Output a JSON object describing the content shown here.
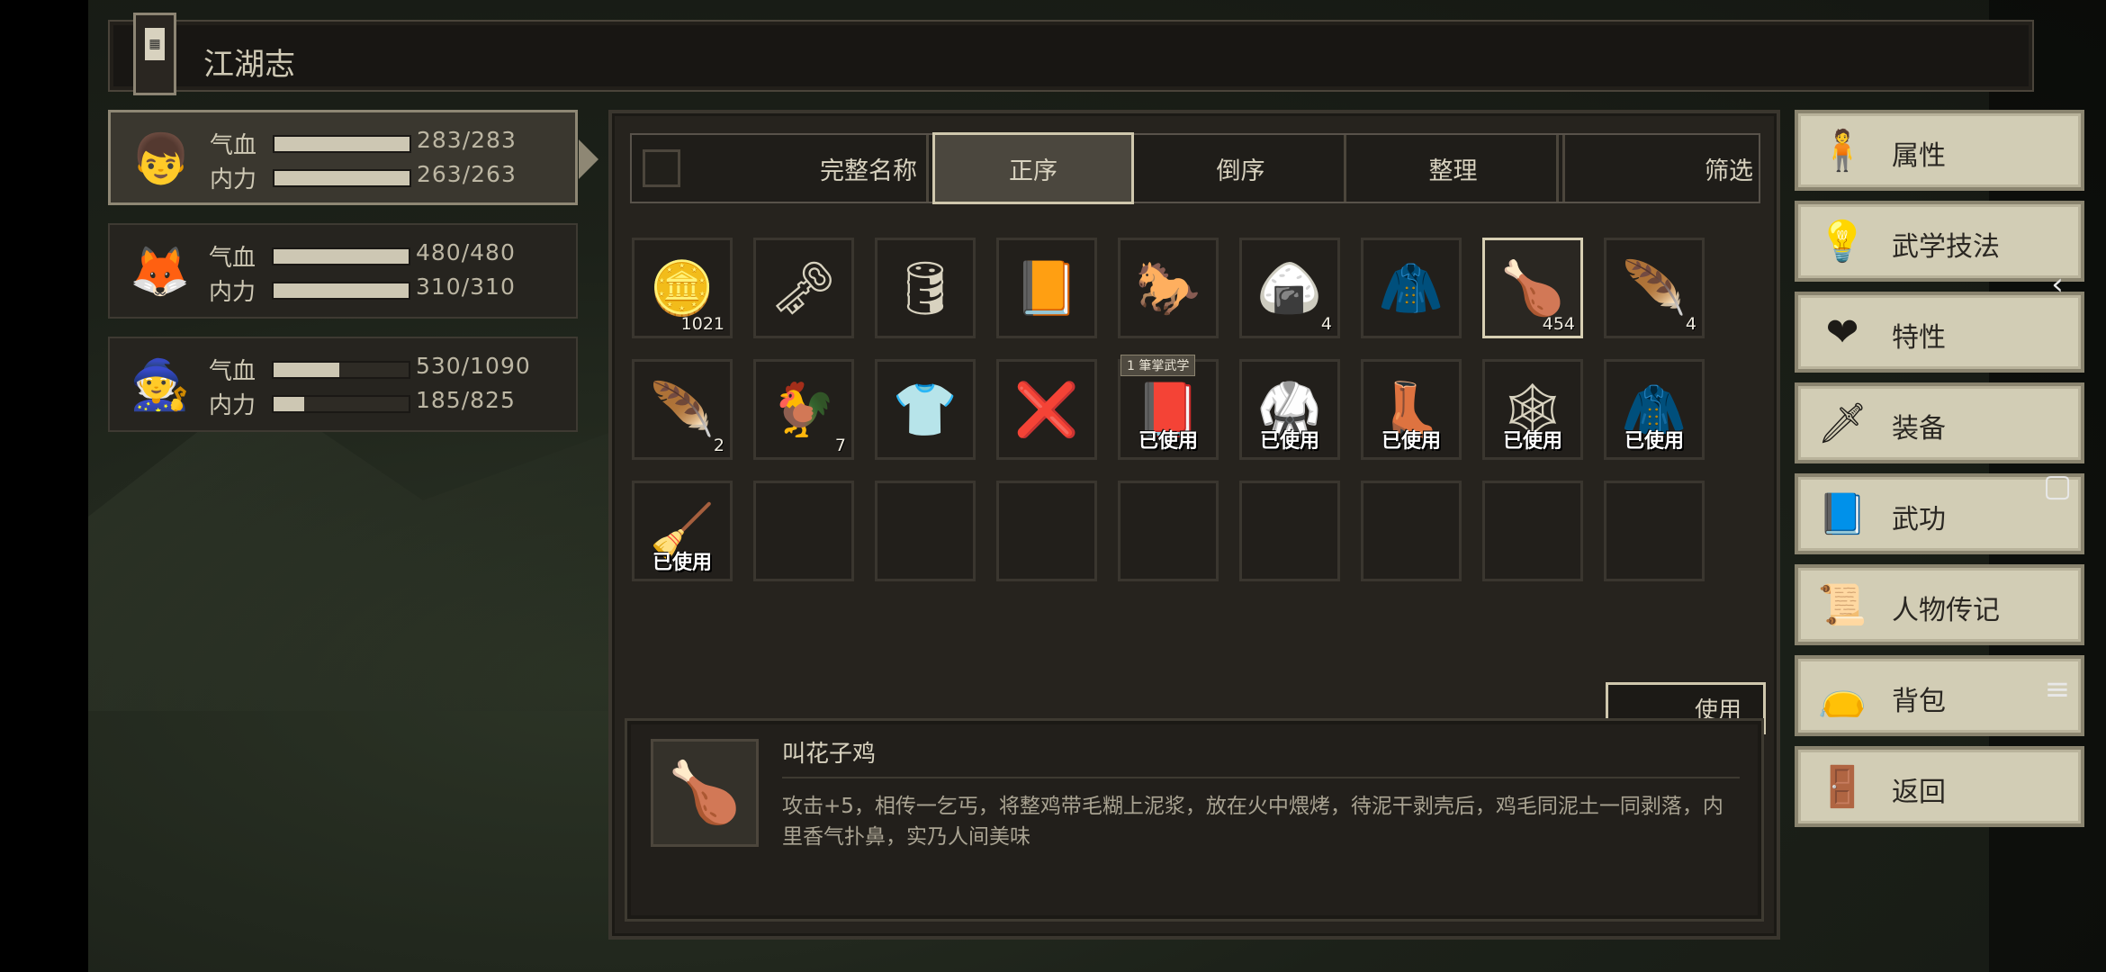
{
  "title": "江湖志",
  "characters": [
    {
      "avatar": "👦",
      "hp_label": "气血",
      "hp": "283/283",
      "hp_ratio": 1.0,
      "mp_label": "内力",
      "mp": "263/263",
      "mp_ratio": 1.0
    },
    {
      "avatar": "🦊",
      "hp_label": "气血",
      "hp": "480/480",
      "hp_ratio": 1.0,
      "mp_label": "内力",
      "mp": "310/310",
      "mp_ratio": 1.0
    },
    {
      "avatar": "🧙",
      "hp_label": "气血",
      "hp": "530/1090",
      "hp_ratio": 0.486,
      "mp_label": "内力",
      "mp": "185/825",
      "mp_ratio": 0.224
    }
  ],
  "toolbar": {
    "full_name": "完整名称",
    "ascending": "正序",
    "descending": "倒序",
    "organize": "整理",
    "filter": "筛选"
  },
  "items": [
    {
      "icon": "🪙",
      "count": "1021",
      "used": "",
      "tag": ""
    },
    {
      "icon": "🗝",
      "count": "",
      "used": "",
      "tag": ""
    },
    {
      "icon": "🛢",
      "count": "",
      "used": "",
      "tag": ""
    },
    {
      "icon": "📙",
      "count": "",
      "used": "",
      "tag": ""
    },
    {
      "icon": "🐎",
      "count": "",
      "used": "",
      "tag": ""
    },
    {
      "icon": "🍙",
      "count": "4",
      "used": "",
      "tag": ""
    },
    {
      "icon": "🧥",
      "count": "",
      "used": "",
      "tag": ""
    },
    {
      "icon": "🍗",
      "count": "454",
      "used": "",
      "tag": ""
    },
    {
      "icon": "🪶",
      "count": "4",
      "used": "",
      "tag": ""
    },
    {
      "icon": "🪶",
      "count": "2",
      "used": "",
      "tag": ""
    },
    {
      "icon": "🐓",
      "count": "7",
      "used": "",
      "tag": ""
    },
    {
      "icon": "👕",
      "count": "",
      "used": "",
      "tag": ""
    },
    {
      "icon": "❌",
      "count": "",
      "used": "",
      "tag": ""
    },
    {
      "icon": "📕",
      "count": "",
      "used": "已使用",
      "tag": "1 筆掌武学"
    },
    {
      "icon": "🥋",
      "count": "",
      "used": "已使用",
      "tag": ""
    },
    {
      "icon": "👢",
      "count": "",
      "used": "已使用",
      "tag": ""
    },
    {
      "icon": "🕸",
      "count": "",
      "used": "已使用",
      "tag": ""
    },
    {
      "icon": "🧥",
      "count": "",
      "used": "已使用",
      "tag": ""
    },
    {
      "icon": "🧹",
      "count": "",
      "used": "已使用",
      "tag": ""
    },
    {
      "icon": "",
      "count": "",
      "used": "",
      "tag": ""
    },
    {
      "icon": "",
      "count": "",
      "used": "",
      "tag": ""
    },
    {
      "icon": "",
      "count": "",
      "used": "",
      "tag": ""
    },
    {
      "icon": "",
      "count": "",
      "used": "",
      "tag": ""
    },
    {
      "icon": "",
      "count": "",
      "used": "",
      "tag": ""
    },
    {
      "icon": "",
      "count": "",
      "used": "",
      "tag": ""
    },
    {
      "icon": "",
      "count": "",
      "used": "",
      "tag": ""
    },
    {
      "icon": "",
      "count": "",
      "used": "",
      "tag": ""
    }
  ],
  "selected_index": 7,
  "use_label": "使用",
  "detail": {
    "icon": "🍗",
    "name": "叫花子鸡",
    "description": "攻击+5，相传一乞丐，将整鸡带毛糊上泥浆，放在火中煨烤，待泥干剥壳后，鸡毛同泥土一同剥落，内里香气扑鼻，实乃人间美味"
  },
  "menu": [
    {
      "icon": "🧍",
      "label": "属性"
    },
    {
      "icon": "💡",
      "label": "武学技法"
    },
    {
      "icon": "❤",
      "label": "特性"
    },
    {
      "icon": "🗡",
      "label": "装备"
    },
    {
      "icon": "📘",
      "label": "武功"
    },
    {
      "icon": "📜",
      "label": "人物传记"
    },
    {
      "icon": "👝",
      "label": "背包"
    },
    {
      "icon": "🚪",
      "label": "返回"
    }
  ],
  "system_nav": {
    "back": "‹",
    "home": "▢",
    "menu": "≡"
  }
}
